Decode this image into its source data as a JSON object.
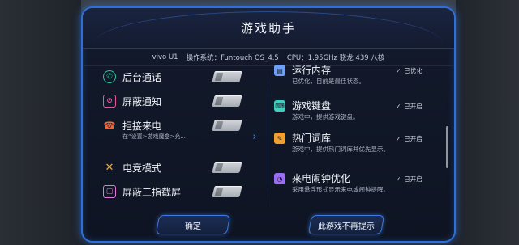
{
  "dialog": {
    "title": "游戏助手"
  },
  "sysinfo": {
    "device": "vivo U1",
    "os_label": "操作系统：",
    "os_value": "Funtouch OS_4.5",
    "cpu_label": "CPU：",
    "cpu_value": "1.95GHz 骁龙 439 八核"
  },
  "toggles": [
    {
      "label": "后台通话",
      "sub": "",
      "icon": "phone-icon",
      "color": "#2ec7a0",
      "glyph": "✆"
    },
    {
      "label": "屏蔽通知",
      "sub": "",
      "icon": "bell-off-icon",
      "color": "#e05aa0",
      "glyph": "⊘"
    },
    {
      "label": "拒接来电",
      "sub": "在“设置>游戏魔盒>允...",
      "icon": "decline-call-icon",
      "color": "#f0683a",
      "glyph": "☎"
    },
    {
      "label": "电竞模式",
      "sub": "",
      "icon": "crossed-swords-icon",
      "color": "#f0a830",
      "glyph": "✕"
    },
    {
      "label": "屏蔽三指截屏",
      "sub": "",
      "icon": "screenshot-off-icon",
      "color": "#e07ad8",
      "glyph": "▢"
    }
  ],
  "features": [
    {
      "title": "运行内存",
      "desc": "已优化，目前是最佳状态。",
      "status": "已优化",
      "icon": "memory-icon",
      "color": "#6fa0f5",
      "glyph": "▤"
    },
    {
      "title": "游戏键盘",
      "desc": "游戏中，提供游戏键盘。",
      "status": "已开启",
      "icon": "keyboard-icon",
      "color": "#3fd0c0",
      "glyph": "⌨"
    },
    {
      "title": "热门词库",
      "desc": "游戏中，提供热门词库并优先显示。",
      "status": "已开启",
      "icon": "dictionary-icon",
      "color": "#f0a030",
      "glyph": "✎"
    },
    {
      "title": "来电闹钟优化",
      "desc": "采用悬浮形式显示来电或闹钟提醒。",
      "status": "已开启",
      "icon": "alarm-icon",
      "color": "#9a6ef0",
      "glyph": "◔"
    }
  ],
  "buttons": {
    "confirm": "确定",
    "dont_remind": "此游戏不再提示"
  },
  "colors": {
    "accent": "#2f6fd8",
    "panel_bg": "#0e1422"
  }
}
